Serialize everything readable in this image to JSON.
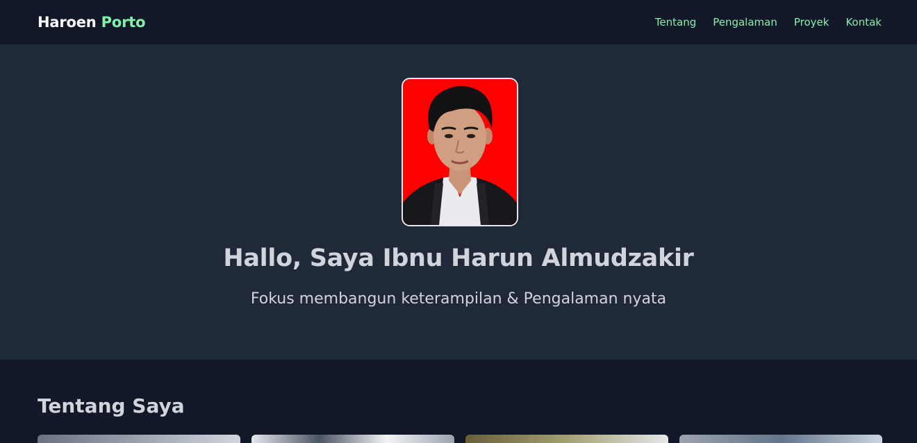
{
  "navbar": {
    "brand_primary": "Haroen",
    "brand_accent": "Porto",
    "links": [
      "Tentang",
      "Pengalaman",
      "Proyek",
      "Kontak"
    ]
  },
  "hero": {
    "title": "Hallo, Saya Ibnu Harun Almudzakir",
    "subtitle": "Fokus membangun keterampilan & Pengalaman nyata"
  },
  "about": {
    "title": "Tentang Saya"
  },
  "colors": {
    "accent": "#86efac",
    "nav_bg": "#111827",
    "hero_bg": "#1f2937",
    "text": "#d1d5db",
    "photo_bg": "#ff0000"
  }
}
